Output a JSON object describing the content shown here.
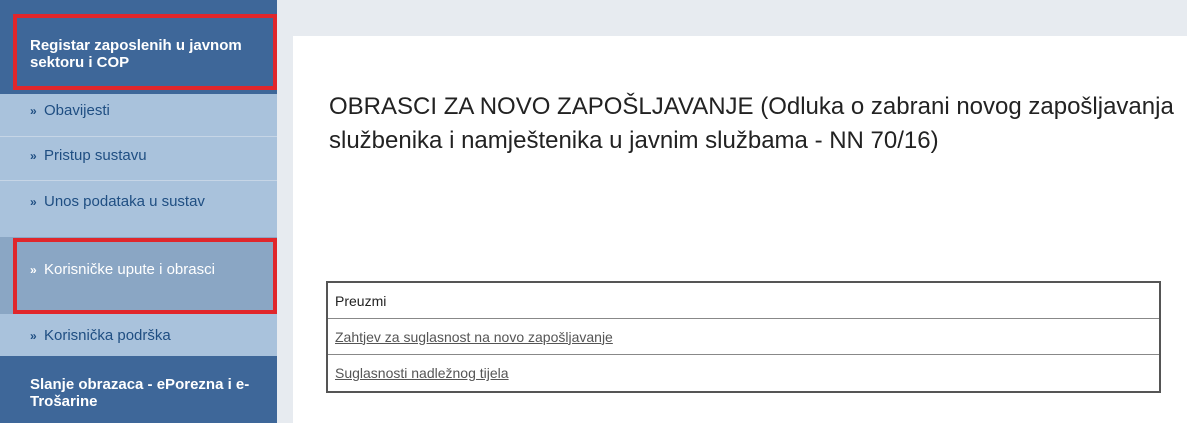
{
  "sidebar": {
    "header_top": "Registar zaposlenih u javnom sektoru i COP",
    "items": [
      {
        "label": "Obavijesti"
      },
      {
        "label": "Pristup sustavu"
      },
      {
        "label": "Unos podataka u sustav"
      },
      {
        "label": "Korisničke upute i obrasci",
        "active": true
      },
      {
        "label": "Korisnička podrška"
      }
    ],
    "header_bottom": "Slanje obrazaca - ePorezna i e-Trošarine",
    "arrow": "»"
  },
  "main": {
    "title": "OBRASCI ZA NOVO ZAPOŠLJAVANJE (Odluka o zabrani novog zapošljavanja službenika i namještenika u javnim službama - NN 70/16)",
    "table": {
      "header": "Preuzmi",
      "links": [
        "Zahtjev za suglasnost na novo zapošljavanje",
        "Suglasnosti nadležnog tijela"
      ]
    }
  },
  "colors": {
    "sidebar_bg": "#a9c2dc",
    "sidebar_header": "#3e6799",
    "highlight": "#e0262b"
  }
}
